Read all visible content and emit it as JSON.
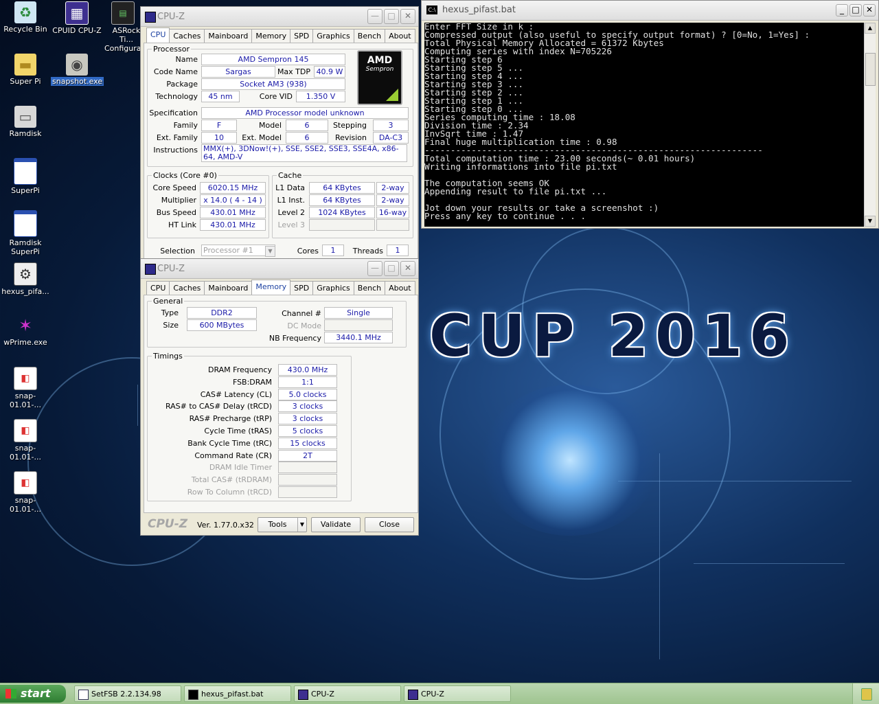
{
  "wallpaper": {
    "title": "CUP 2016"
  },
  "desktop_icons": [
    {
      "label": "Recycle Bin",
      "icon": "recycle-bin-icon"
    },
    {
      "label": "CPUID CPU-Z",
      "icon": "cpuz-icon"
    },
    {
      "label": "ASRock Ti... Configura...",
      "icon": "asrock-icon"
    },
    {
      "label": "Super Pi",
      "icon": "folder-icon"
    },
    {
      "label": "snapshot.exe",
      "icon": "camera-icon"
    },
    {
      "label": "Ramdisk",
      "icon": "drive-icon"
    },
    {
      "label": "SuperPi",
      "icon": "window-icon"
    },
    {
      "label": "Ramdisk SuperPi",
      "icon": "window-icon"
    },
    {
      "label": "hexus_pifa...",
      "icon": "gear-icon"
    },
    {
      "label": "wPrime.exe",
      "icon": "wprime-icon"
    },
    {
      "label": "snap-01.01-...",
      "icon": "image-file-icon"
    },
    {
      "label": "snap-01.01-...",
      "icon": "image-file-icon"
    },
    {
      "label": "snap-01.01-...",
      "icon": "image-file-icon"
    }
  ],
  "cpuz_cpu": {
    "title": "CPU-Z",
    "tabs": [
      "CPU",
      "Caches",
      "Mainboard",
      "Memory",
      "SPD",
      "Graphics",
      "Bench",
      "About"
    ],
    "active_tab": "CPU",
    "processor_legend": "Processor",
    "name_label": "Name",
    "name": "AMD Sempron 145",
    "codename_label": "Code Name",
    "codename": "Sargas",
    "maxtdp_label": "Max TDP",
    "maxtdp": "40.9 W",
    "package_label": "Package",
    "package": "Socket AM3 (938)",
    "technology_label": "Technology",
    "technology": "45 nm",
    "corevid_label": "Core VID",
    "corevid": "1.350 V",
    "spec_label": "Specification",
    "spec": "AMD Processor model unknown",
    "family_label": "Family",
    "family": "F",
    "model_label": "Model",
    "model": "6",
    "stepping_label": "Stepping",
    "stepping": "3",
    "extfamily_label": "Ext. Family",
    "extfamily": "10",
    "extmodel_label": "Ext. Model",
    "extmodel": "6",
    "revision_label": "Revision",
    "revision": "DA-C3",
    "instructions_label": "Instructions",
    "instructions": "MMX(+), 3DNow!(+), SSE, SSE2, SSE3, SSE4A, x86-64, AMD-V",
    "logo_brand": "AMD",
    "logo_sub": "Sempron",
    "clocks_legend": "Clocks (Core #0)",
    "corespeed_label": "Core Speed",
    "corespeed": "6020.15 MHz",
    "multiplier_label": "Multiplier",
    "multiplier": "x 14.0 ( 4 - 14 )",
    "busspeed_label": "Bus Speed",
    "busspeed": "430.01 MHz",
    "htlink_label": "HT Link",
    "htlink": "430.01 MHz",
    "cache_legend": "Cache",
    "l1data_label": "L1 Data",
    "l1data": "64 KBytes",
    "l1data_way": "2-way",
    "l1inst_label": "L1 Inst.",
    "l1inst": "64 KBytes",
    "l1inst_way": "2-way",
    "level2_label": "Level 2",
    "level2": "1024 KBytes",
    "level2_way": "16-way",
    "level3_label": "Level 3",
    "selection_label": "Selection",
    "selection": "Processor #1",
    "cores_label": "Cores",
    "cores": "1",
    "threads_label": "Threads",
    "threads": "1"
  },
  "cpuz_mem": {
    "title": "CPU-Z",
    "tabs": [
      "CPU",
      "Caches",
      "Mainboard",
      "Memory",
      "SPD",
      "Graphics",
      "Bench",
      "About"
    ],
    "active_tab": "Memory",
    "general_legend": "General",
    "type_label": "Type",
    "type": "DDR2",
    "size_label": "Size",
    "size": "600 MBytes",
    "channel_label": "Channel #",
    "channel": "Single",
    "dcmode_label": "DC Mode",
    "nbfreq_label": "NB Frequency",
    "nbfreq": "3440.1 MHz",
    "timings_legend": "Timings",
    "timings": [
      {
        "label": "DRAM Frequency",
        "value": "430.0 MHz"
      },
      {
        "label": "FSB:DRAM",
        "value": "1:1"
      },
      {
        "label": "CAS# Latency (CL)",
        "value": "5.0 clocks"
      },
      {
        "label": "RAS# to CAS# Delay (tRCD)",
        "value": "3 clocks"
      },
      {
        "label": "RAS# Precharge (tRP)",
        "value": "3 clocks"
      },
      {
        "label": "Cycle Time (tRAS)",
        "value": "5 clocks"
      },
      {
        "label": "Bank Cycle Time (tRC)",
        "value": "15 clocks"
      },
      {
        "label": "Command Rate (CR)",
        "value": "2T"
      },
      {
        "label": "DRAM Idle Timer",
        "value": ""
      },
      {
        "label": "Total CAS# (tRDRAM)",
        "value": ""
      },
      {
        "label": "Row To Column (tRCD)",
        "value": ""
      }
    ],
    "brand": "CPU-Z",
    "version": "Ver. 1.77.0.x32",
    "tools_label": "Tools",
    "validate_label": "Validate",
    "close_label": "Close"
  },
  "console": {
    "title": "hexus_pifast.bat",
    "icon_text": "C:\\",
    "lines": [
      "Enter FFT Size in k :",
      "Compressed output (also useful to specify output format) ? [0=No, 1=Yes] :",
      "Total Physical Memory Allocated = 61372 Kbytes",
      "Computing series with index N=705226",
      "Starting step 6",
      "Starting step 5 ...",
      "Starting step 4 ...",
      "Starting step 3 ...",
      "Starting step 2 ...",
      "Starting step 1 ...",
      "Starting step 0 ...",
      "Series computing time : 18.08",
      "Division time : 2.34",
      "InvSqrt time : 1.47",
      "Final huge multiplication time : 0.98",
      "-----------------------------------------------------------------",
      "Total computation time : 23.00 seconds(~ 0.01 hours)",
      "Writing informations into file pi.txt",
      "",
      "The computation seems OK",
      "Appending result to file pi.txt ...",
      "",
      "Jot down your results or take a screenshot :)",
      "Press any key to continue . . ."
    ]
  },
  "taskbar": {
    "start_label": "start",
    "tasks": [
      {
        "label": "SetFSB 2.2.134.98",
        "icon": "setfsb-icon"
      },
      {
        "label": "hexus_pifast.bat",
        "icon": "console-icon"
      },
      {
        "label": "CPU-Z",
        "icon": "cpuz-icon"
      },
      {
        "label": "CPU-Z",
        "icon": "cpuz-icon"
      }
    ]
  }
}
